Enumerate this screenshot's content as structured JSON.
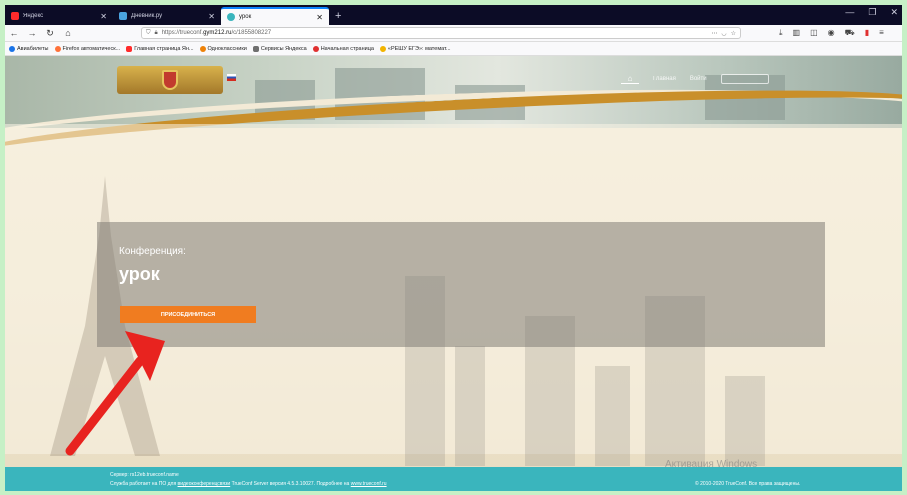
{
  "browser": {
    "tabs": [
      {
        "label": "Яндекс",
        "favicon_color": "#ff2b2b",
        "active": false
      },
      {
        "label": "Дневник.ру",
        "favicon_color": "#4aa3df",
        "active": false
      },
      {
        "label": "урок",
        "favicon_color": "#3ab5bd",
        "active": true
      }
    ],
    "new_tab": "+",
    "url_prefix": "https://trueconf.",
    "url_domain": "gym212.ru",
    "url_suffix": "/c/1855808227",
    "bookmarks": [
      {
        "label": "Авиабилеты",
        "color": "#1a73e8"
      },
      {
        "label": "Firefox автоматическ...",
        "color": "#ff7139"
      },
      {
        "label": "Главная страница Ян...",
        "color": "#ff2b2b"
      },
      {
        "label": "Одноклассники",
        "color": "#ee8208"
      },
      {
        "label": "Сервисы Яндекса",
        "color": "#6f6f6f"
      },
      {
        "label": "Начальная страница",
        "color": "#e03030"
      },
      {
        "label": "«РЕШУ ЕГЭ»: математ...",
        "color": "#f2b400"
      }
    ]
  },
  "site": {
    "nav_items": [
      "Главная",
      "Войти"
    ]
  },
  "conference": {
    "label": "Конференция:",
    "title": "урок",
    "join_label": "ПРИСОЕДИНИТЬСЯ"
  },
  "footer": {
    "server": "Сервер: rs12eb.trueconf.name",
    "about_prefix": "Служба работает на ПО для ",
    "about_link": "видеоконференцсвязи",
    "about_mid": " TrueConf Server версия 4.5.3.10027. Подробнее на ",
    "about_site": "www.trueconf.ru",
    "copyright": "© 2010-2020 TrueConf. Все права защищены."
  },
  "watermark": "Активация Windows",
  "colors": {
    "accent": "#f07c20",
    "footer": "#3ab5bd",
    "arrow": "#e8231f"
  }
}
